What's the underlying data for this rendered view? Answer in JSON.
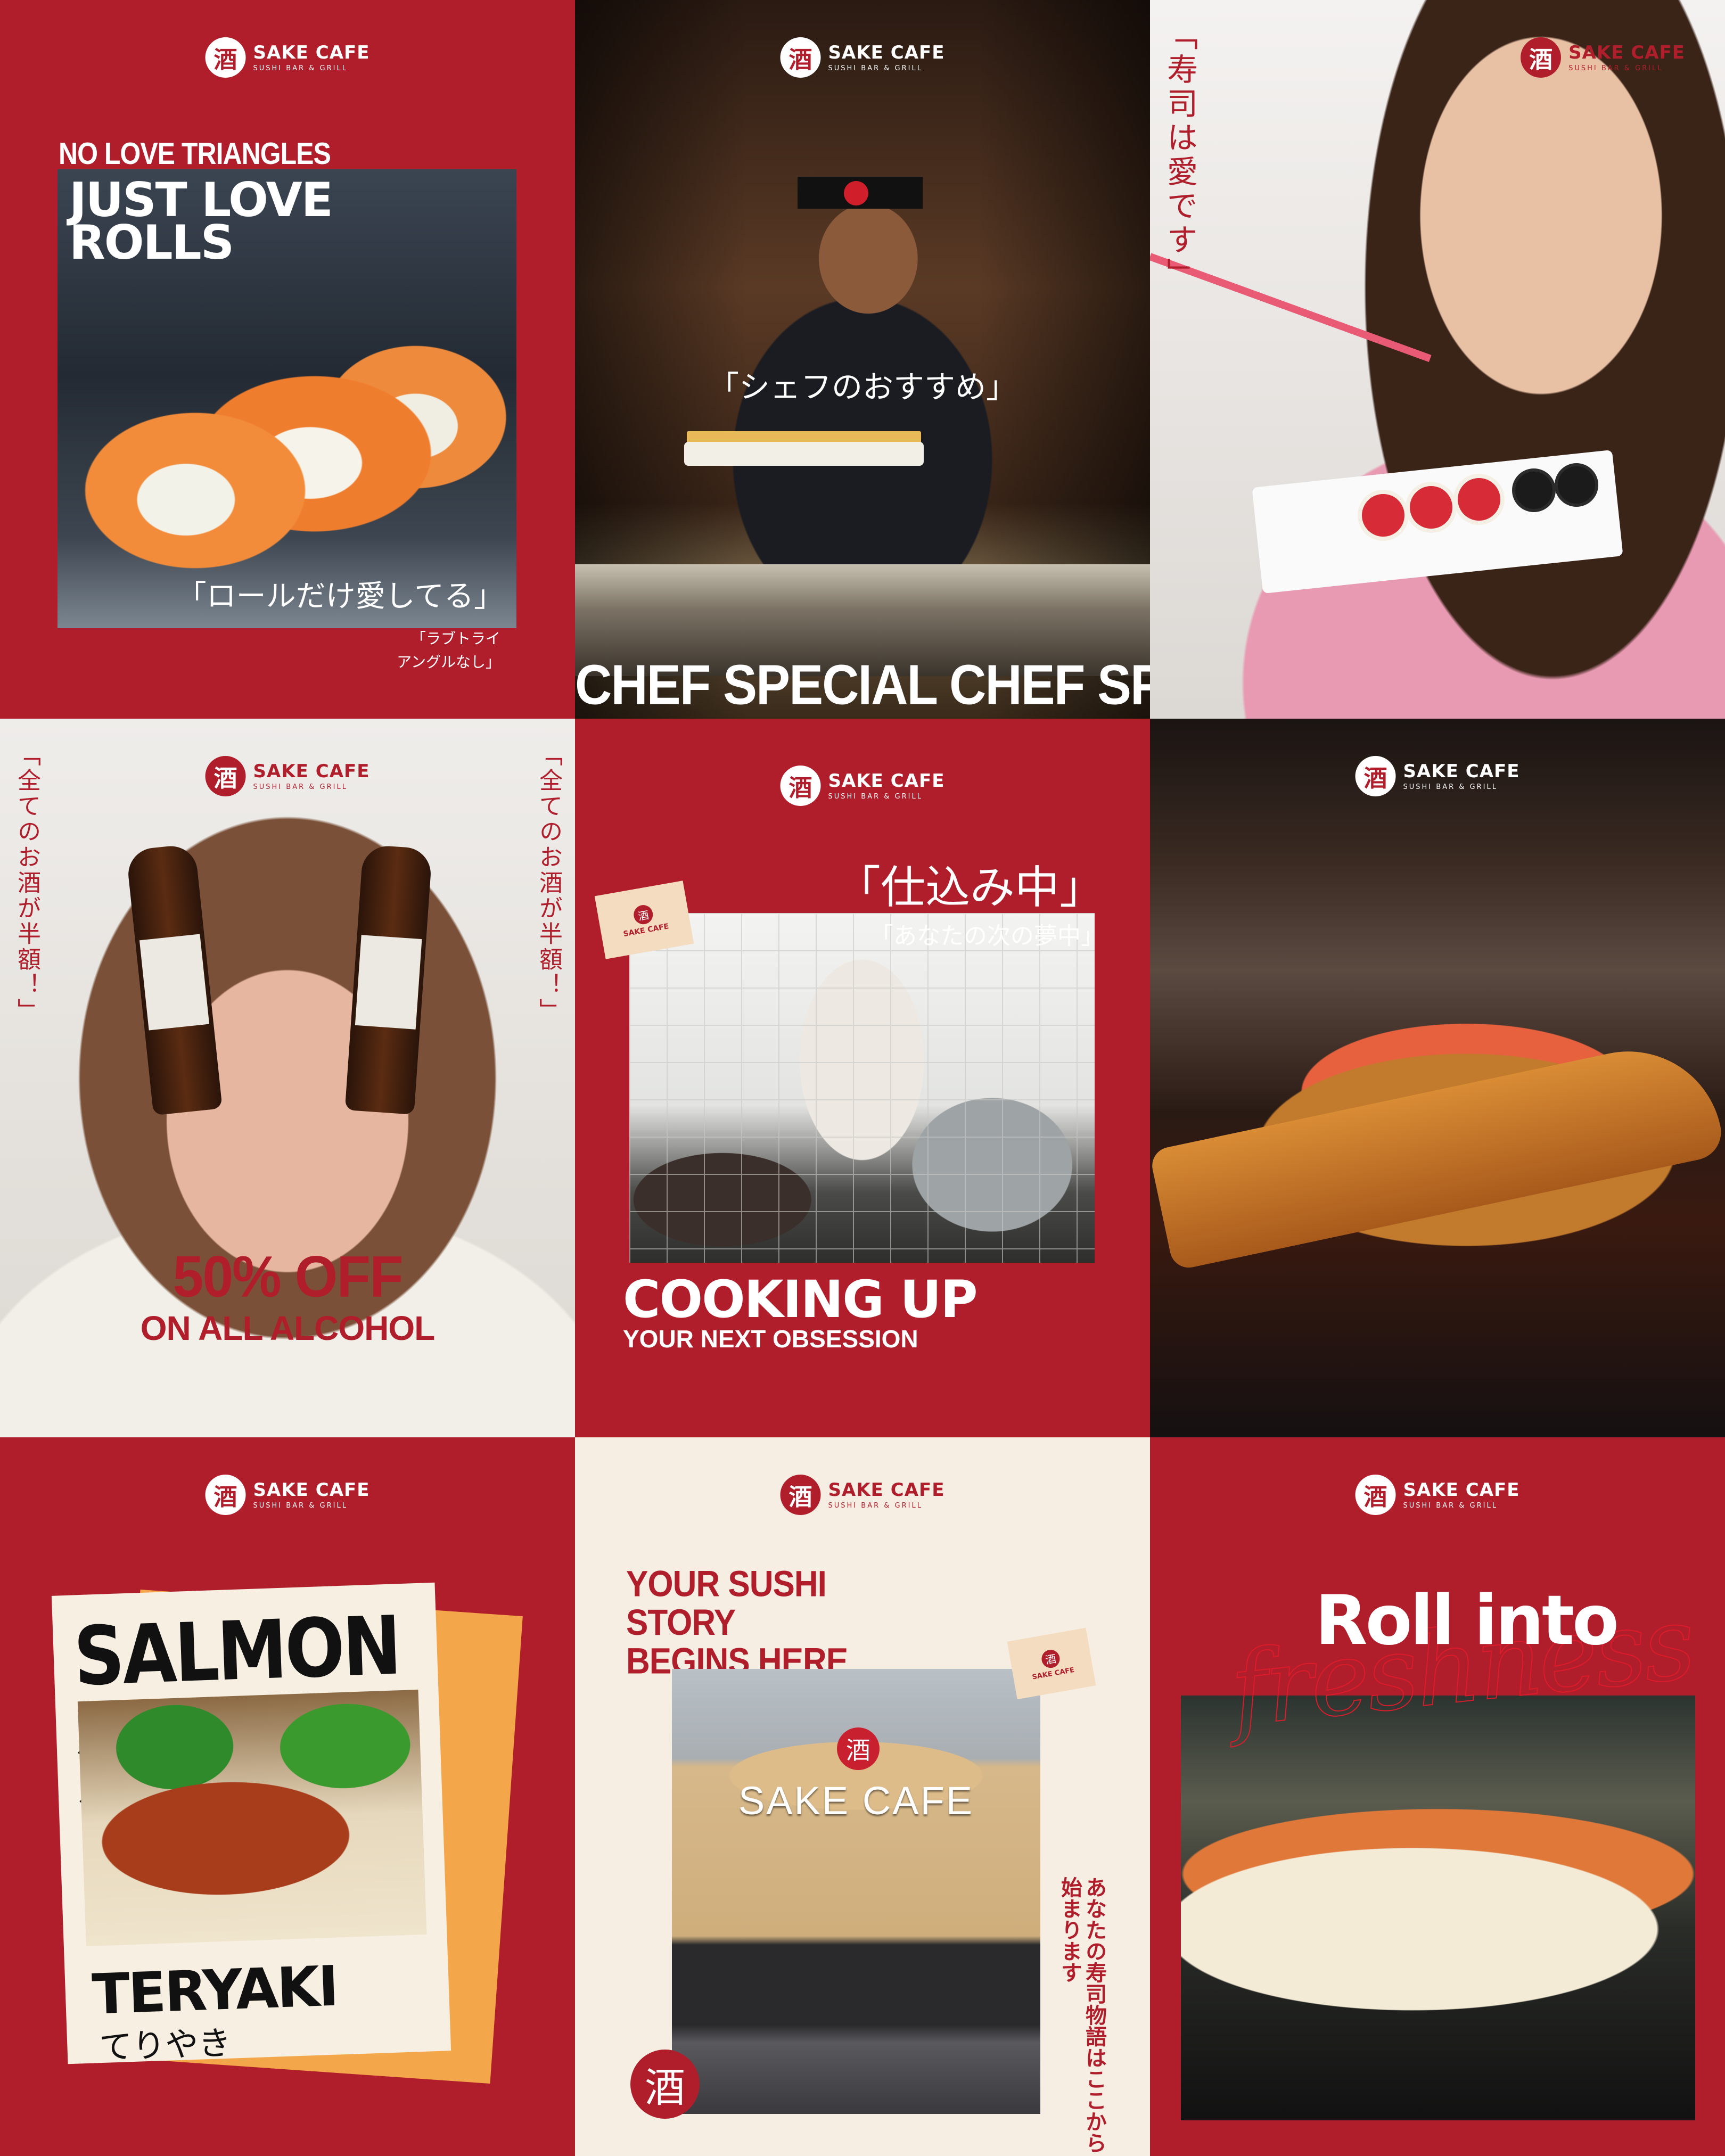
{
  "brand": {
    "mark": "酒",
    "name": "SAKE CAFE",
    "sub": "SUSHI BAR & GRILL"
  },
  "colors": {
    "brand_red": "#b01e2c",
    "cream": "#f6eee3",
    "white": "#ffffff"
  },
  "tile1": {
    "kicker": "NO LOVE TRIANGLES",
    "headline_line1": "JUST LOVE",
    "headline_line2": "ROLLS",
    "jp_headline": "「ロールだけ愛してる」",
    "jp_small_line1": "「ラブトライ",
    "jp_small_line2": "アングルなし」"
  },
  "tile2": {
    "jp_caption": "「シェフのおすすめ」",
    "marquee": "CHEF SPECIAL  CHEF SPECIAL"
  },
  "tile3": {
    "jp_vertical": "「寿司は愛です」"
  },
  "tile4": {
    "jp_vertical_left": "「全てのお酒が半額！」",
    "jp_vertical_right": "「全てのお酒が半額！」",
    "offer_line1": "50% OFF",
    "offer_line2": "ON ALL ALCOHOL"
  },
  "tile5": {
    "jp_headline": "「仕込み中」",
    "jp_sub": "「あなたの次の夢中」",
    "stamp_text": "SAKE CAFE",
    "headline": "COOKING UP",
    "subline": "YOUR NEXT OBSESSION"
  },
  "tile7": {
    "top_word": "SALMON 鮭",
    "bottom_word": "TERYAKI",
    "bottom_jp": "てりやき"
  },
  "tile8": {
    "headline_line1": "YOUR SUSHI",
    "headline_line2": "STORY",
    "headline_line3": "BEGINS HERE",
    "sign_text": "SAKE CAFE",
    "stamp_text": "SAKE CAFE",
    "jp_vertical": "あなたの寿司物語はここから始まります"
  },
  "tile9": {
    "headline": "Roll into",
    "script": "freshness"
  }
}
